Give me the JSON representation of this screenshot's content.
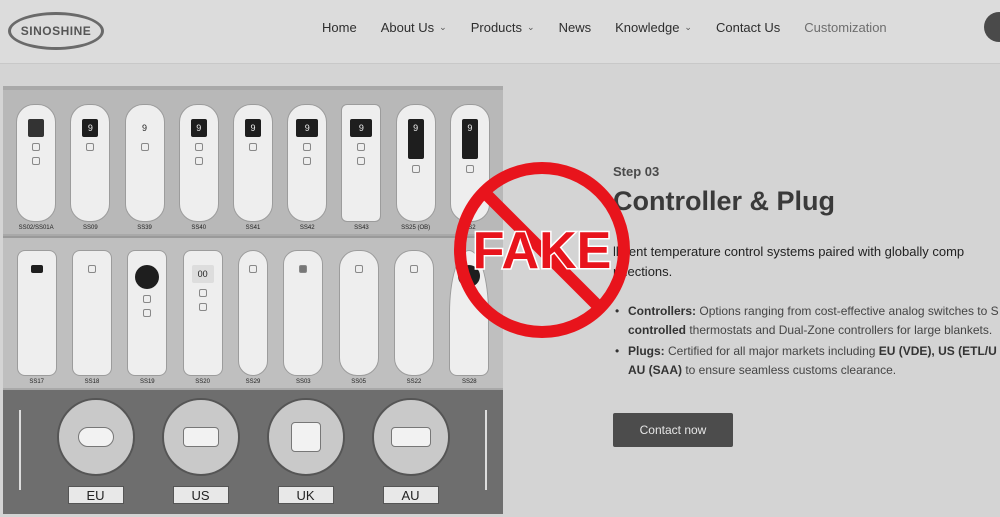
{
  "header": {
    "logo_text": "SINOSHINE",
    "nav": [
      {
        "label": "Home",
        "has_dropdown": false
      },
      {
        "label": "About Us",
        "has_dropdown": true
      },
      {
        "label": "Products",
        "has_dropdown": true
      },
      {
        "label": "News",
        "has_dropdown": false
      },
      {
        "label": "Knowledge",
        "has_dropdown": true
      },
      {
        "label": "Contact Us",
        "has_dropdown": false
      },
      {
        "label": "Customization",
        "has_dropdown": false
      }
    ]
  },
  "product_image": {
    "row1_models": [
      "SS02/SS01A",
      "SS09",
      "SS39",
      "SS40",
      "SS41",
      "SS42",
      "SS43",
      "SS25 (OB)",
      "SS2"
    ],
    "row2_models": [
      "SS17",
      "SS18",
      "SS19",
      "SS20",
      "SS29",
      "SS03",
      "SS05",
      "SS22",
      "SS28"
    ],
    "plugs": [
      "EU",
      "US",
      "UK",
      "AU"
    ]
  },
  "content": {
    "step": "Step 03",
    "title": "Controller & Plug",
    "intro": "lligent temperature control systems paired with globally comp nnections.",
    "bullets": [
      {
        "label": "Controllers:",
        "text": "Options ranging from cost-effective analog switches to S",
        "bold_tail": "controlled",
        "text2": " thermostats and Dual-Zone controllers for large blankets."
      },
      {
        "label": "Plugs:",
        "text": "Certified for all major markets including ",
        "bold_tail": "EU (VDE), US (ETL/U",
        "text2": "",
        "line2_bold": "AU (SAA)",
        "line2_text": " to ensure seamless customs clearance."
      }
    ],
    "cta_label": "Contact now"
  },
  "overlay": {
    "stamp_text": "FAKE",
    "stamp_color": "#e8141c"
  },
  "colors": {
    "page_bg": "#d4d4d4",
    "button_bg": "#4c4c4c"
  }
}
